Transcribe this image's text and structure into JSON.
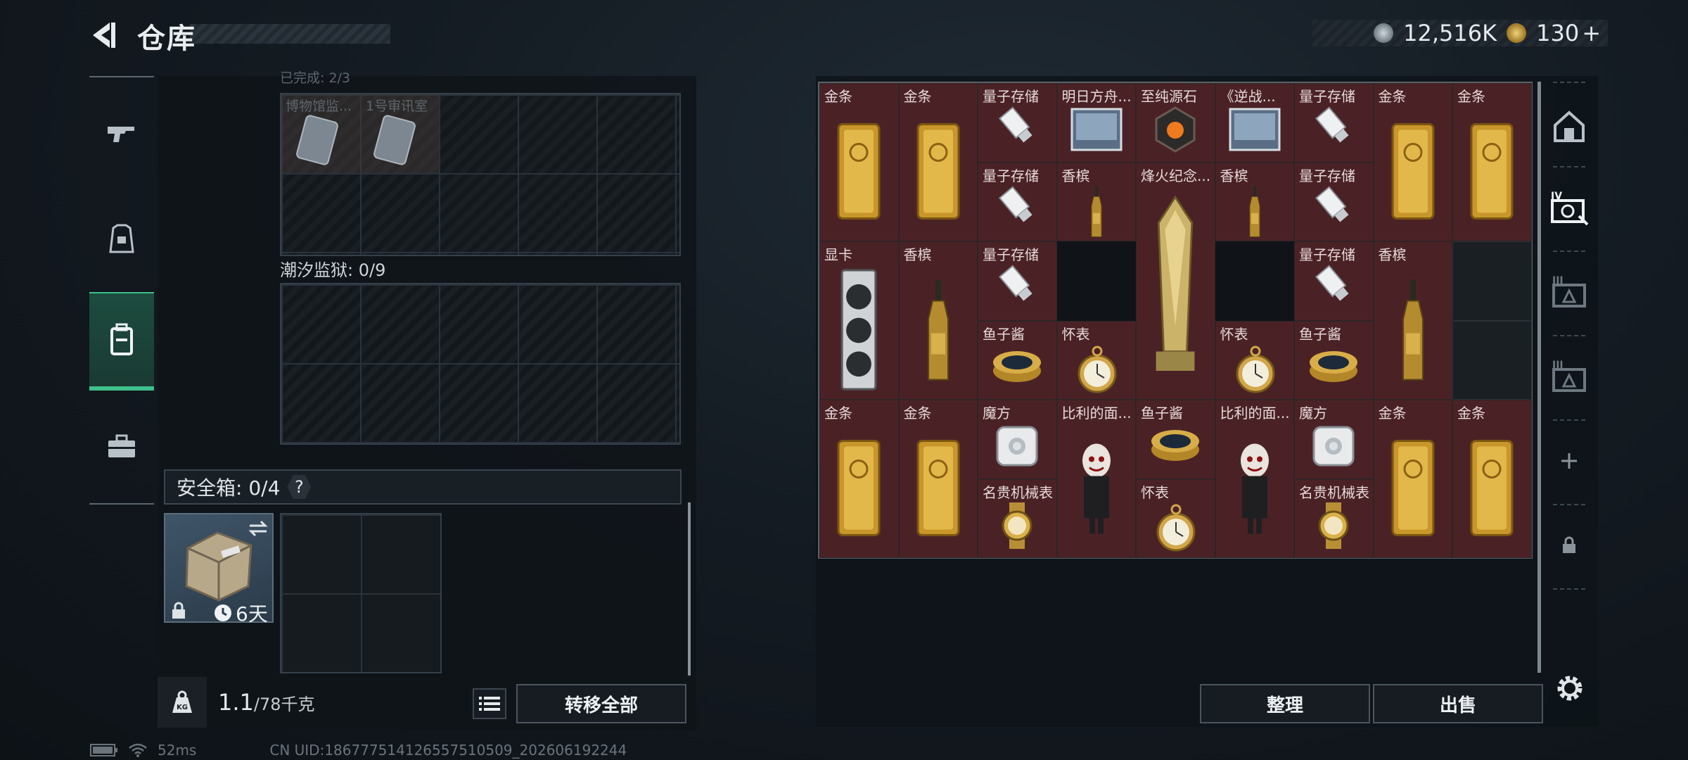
{
  "header": {
    "title": "仓库",
    "back_icon": "back-arrow-icon"
  },
  "currency": {
    "coins": "12,516K",
    "premium": "130",
    "plus": "+"
  },
  "left_nav": {
    "items": [
      "weapon-icon",
      "armor-icon",
      "backpack-icon",
      "briefcase-icon"
    ],
    "active_index": 2
  },
  "storage": {
    "section1_label": "已完成: 2/3",
    "section1_items": [
      "博物馆监...",
      "1号审讯室"
    ],
    "section2_label": "潮汐监狱: 0/9"
  },
  "safe": {
    "label": "安全箱: 0/4",
    "help": "?",
    "timer": "6天"
  },
  "weight": {
    "current": "1.1",
    "capacity": "/78千克"
  },
  "buttons": {
    "transfer_all": "转移全部",
    "sort": "整理",
    "sell": "出售"
  },
  "status": {
    "ping": "52ms",
    "uid": "CN UID:186777514126557510509_202606192244"
  },
  "inventory": {
    "rows": [
      [
        "金条",
        "金条",
        "量子存储",
        "明日方舟...",
        "至纯源石",
        "《逆战...",
        "量子存储",
        "金条",
        "金条"
      ],
      [
        "",
        "",
        "量子存储",
        "香槟",
        "烽火纪念...",
        "香槟",
        "量子存储",
        "",
        ""
      ],
      [
        "显卡",
        "香槟",
        "量子存储",
        "",
        "",
        "",
        "量子存储",
        "香槟",
        ""
      ],
      [
        "",
        "",
        "鱼子酱",
        "怀表",
        "",
        "怀表",
        "鱼子酱",
        "",
        ""
      ],
      [
        "金条",
        "金条",
        "魔方",
        "比利的面...",
        "鱼子酱",
        "比利的面...",
        "魔方",
        "金条",
        "金条"
      ],
      [
        "",
        "",
        "名贵机械表",
        "",
        "怀表",
        "",
        "名贵机械表",
        "",
        ""
      ]
    ]
  },
  "colors": {
    "accent": "#3ec08a",
    "cell_bg": "#4a2226",
    "gold": "#d4a73a"
  }
}
